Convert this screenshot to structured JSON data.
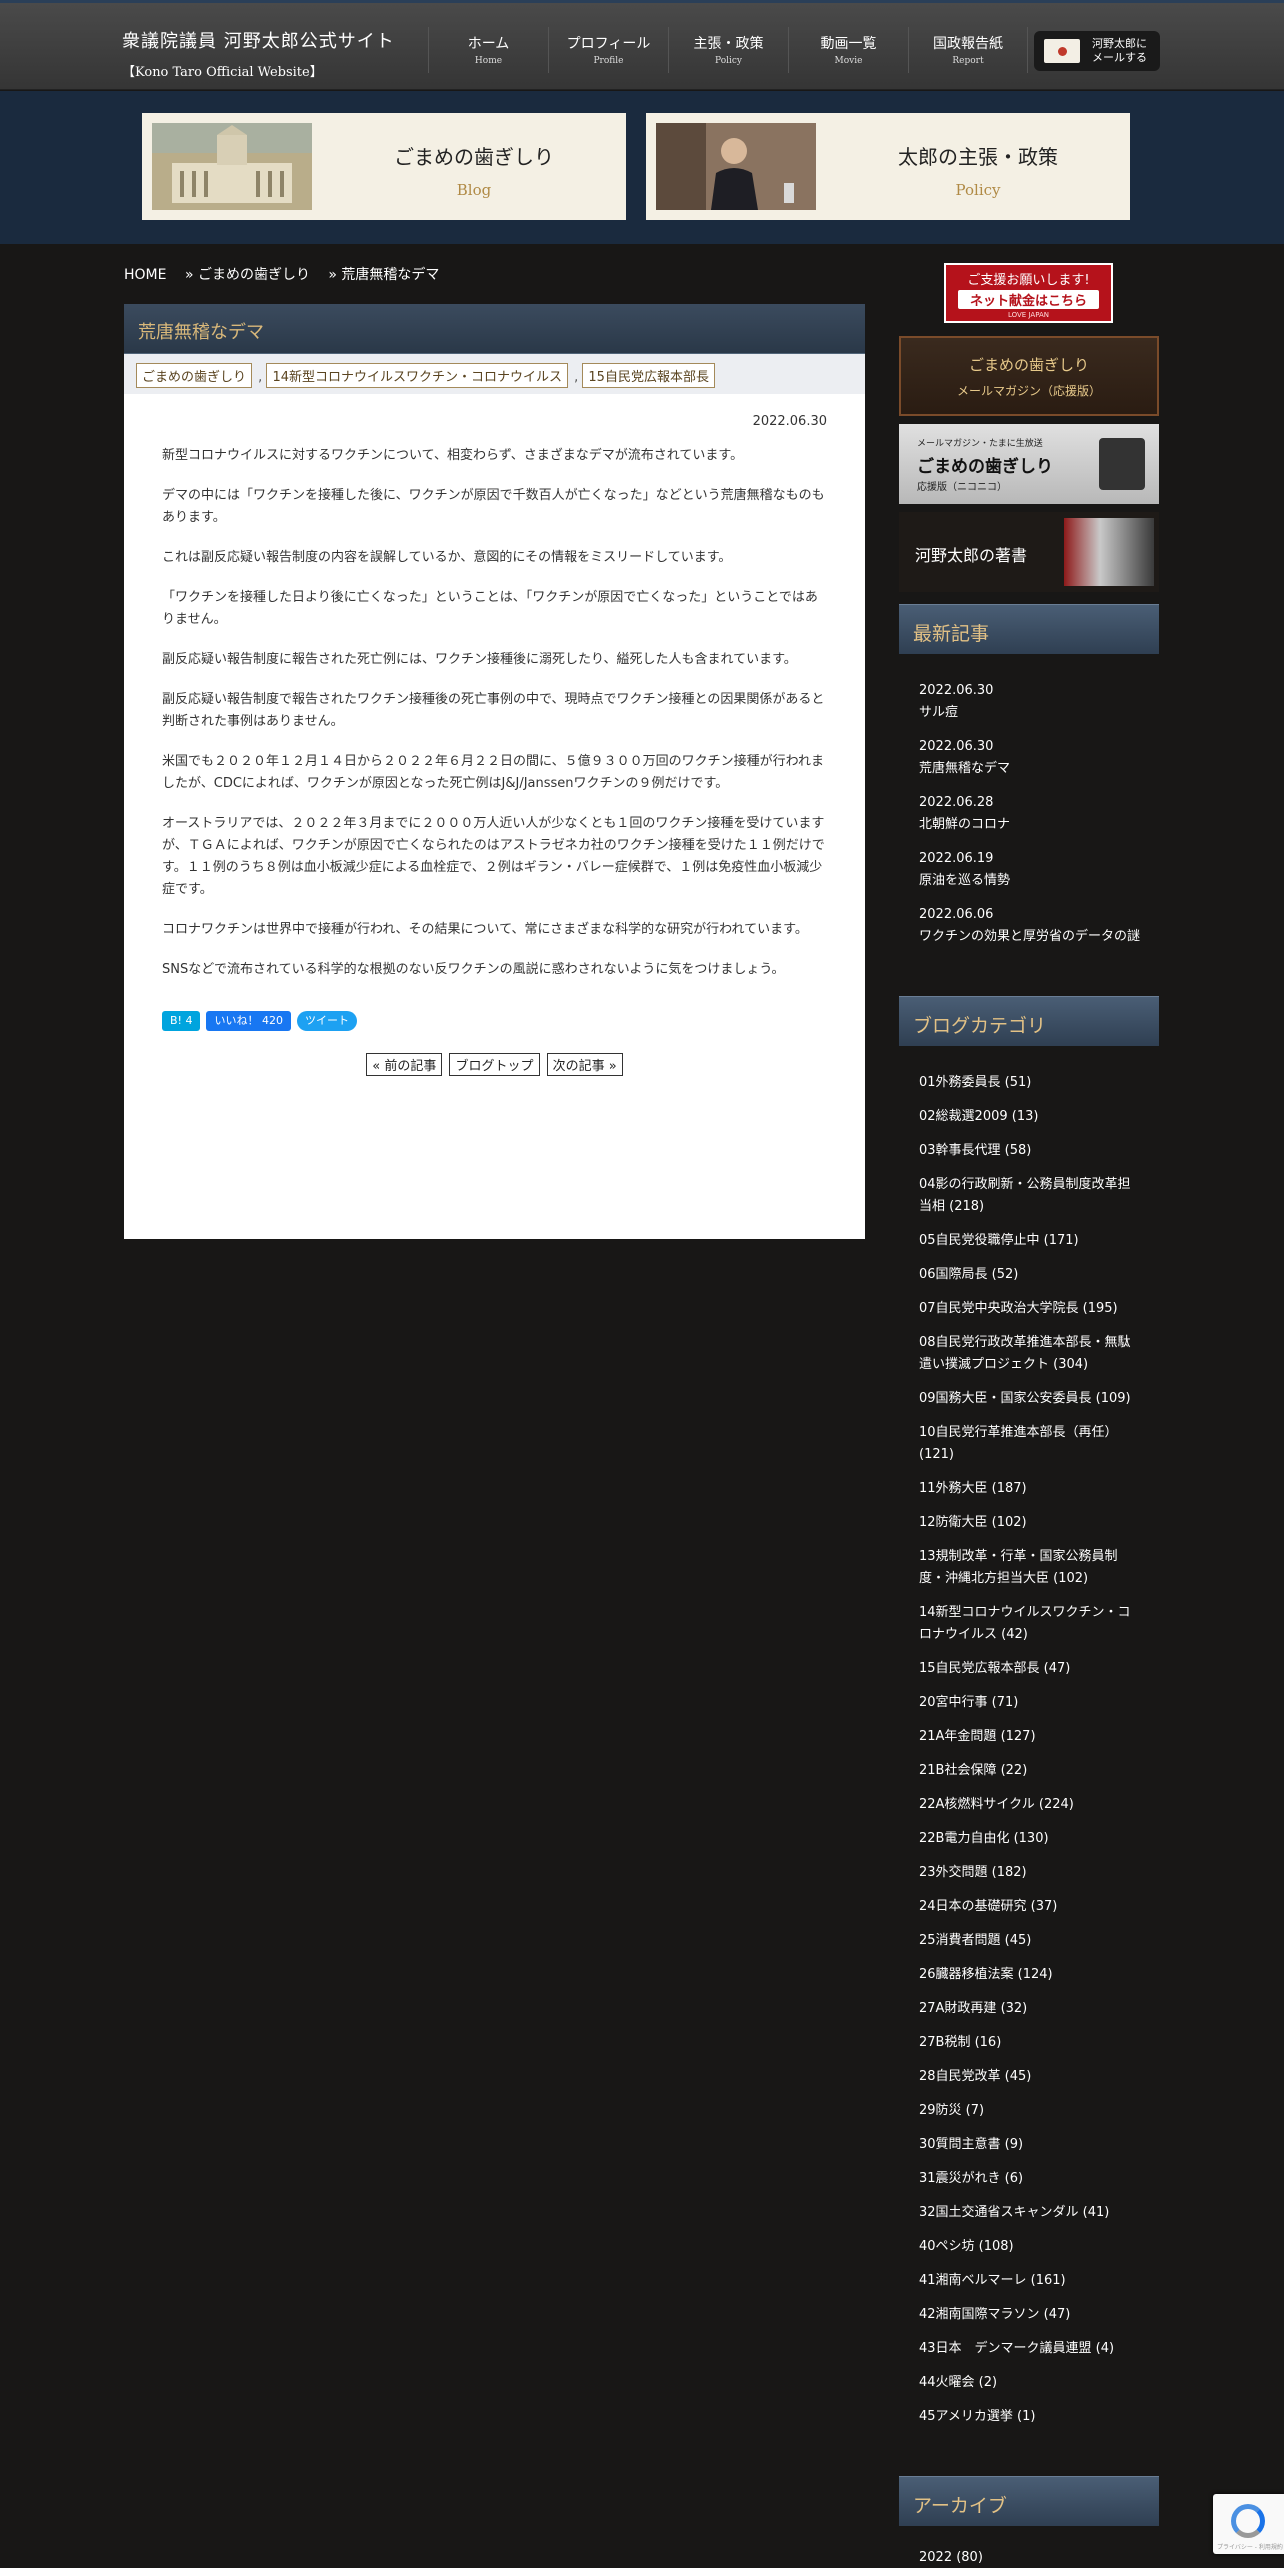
{
  "header": {
    "site_title": "衆議院議員 河野太郎公式サイト",
    "site_subtitle": "【Kono Taro Official Website】",
    "nav": [
      {
        "jp": "ホーム",
        "en": "Home"
      },
      {
        "jp": "プロフィール",
        "en": "Profile"
      },
      {
        "jp": "主張・政策",
        "en": "Policy"
      },
      {
        "jp": "動画一覧",
        "en": "Movie"
      },
      {
        "jp": "国政報告紙",
        "en": "Report"
      }
    ],
    "mail_line1": "河野太郎に",
    "mail_line2": "メールする"
  },
  "banners": [
    {
      "title": "ごまめの歯ぎしり",
      "sub": "Blog"
    },
    {
      "title": "太郎の主張・政策",
      "sub": "Policy"
    }
  ],
  "breadcrumb": {
    "home": "HOME",
    "level1": "» ごまめの歯ぎしり",
    "level2": "» 荒唐無稽なデマ"
  },
  "post": {
    "title": "荒唐無稽なデマ",
    "tags": [
      "ごまめの歯ぎしり",
      "14新型コロナウイルスワクチン・コロナウイルス",
      "15自民党広報本部長"
    ],
    "sep": ",",
    "date": "2022.06.30",
    "paragraphs": [
      "新型コロナウイルスに対するワクチンについて、相変わらず、さまざまなデマが流布されています。",
      "デマの中には「ワクチンを接種した後に、ワクチンが原因で千数百人が亡くなった」などという荒唐無稽なものもあります。",
      "これは副反応疑い報告制度の内容を誤解しているか、意図的にその情報をミスリードしています。",
      "「ワクチンを接種した日より後に亡くなった」ということは、「ワクチンが原因で亡くなった」ということではありません。",
      "副反応疑い報告制度に報告された死亡例には、ワクチン接種後に溺死したり、縊死した人も含まれています。",
      "副反応疑い報告制度で報告されたワクチン接種後の死亡事例の中で、現時点でワクチン接種との因果関係があると判断された事例はありません。",
      "米国でも２０２０年１２月１４日から２０２２年６月２２日の間に、５億９３００万回のワクチン接種が行われましたが、CDCによれば、ワクチンが原因となった死亡例はJ&J/Janssenワクチンの９例だけです。",
      "オーストラリアでは、２０２２年３月までに２０００万人近い人が少なくとも１回のワクチン接種を受けていますが、ＴＧＡによれば、ワクチンが原因で亡くなられたのはアストラゼネカ社のワクチン接種を受けた１１例だけです。１１例のうち８例は血小板減少症による血栓症で、２例はギラン・バレー症候群で、１例は免疫性血小板減少症です。",
      "コロナワクチンは世界中で接種が行われ、その結果について、常にさまざまな科学的な研究が行われています。",
      "SNSなどで流布されている科学的な根拠のない反ワクチンの風説に惑わされないように気をつけましょう。"
    ],
    "share": {
      "hatena": "B! 4",
      "facebook": "いいね！ 420",
      "tweet": "ツイート"
    },
    "pager": {
      "prev": "« 前の記事",
      "top": "ブログトップ",
      "next": "次の記事 »"
    }
  },
  "sidebar": {
    "donate": {
      "line1": "ご支援お願いします!",
      "line2": "ネット献金はこちら",
      "line3": "LOVE JAPAN"
    },
    "gomame_banner": {
      "line1": "ごまめの歯ぎしり",
      "line2": "メールマガジン（応援版）"
    },
    "niconico_banner": {
      "line1": "メールマガジン・たまに生放送",
      "line2": "ごまめの歯ぎしり",
      "line3": "応援版（ニコニコ）"
    },
    "books_banner": {
      "line1": "河野太郎の著書"
    },
    "recent_title": "最新記事",
    "recent": [
      {
        "date": "2022.06.30",
        "title": "サル痘"
      },
      {
        "date": "2022.06.30",
        "title": "荒唐無稽なデマ"
      },
      {
        "date": "2022.06.28",
        "title": "北朝鮮のコロナ"
      },
      {
        "date": "2022.06.19",
        "title": "原油を巡る情勢"
      },
      {
        "date": "2022.06.06",
        "title": "ワクチンの効果と厚労省のデータの謎"
      }
    ],
    "category_title": "ブログカテゴリ",
    "categories": [
      "01外務委員長 (51)",
      "02総裁選2009 (13)",
      "03幹事長代理 (58)",
      "04影の行政刷新・公務員制度改革担当相 (218)",
      "05自民党役職停止中 (171)",
      "06国際局長 (52)",
      "07自民党中央政治大学院長 (195)",
      "08自民党行政改革推進本部長・無駄遣い撲滅プロジェクト (304)",
      "09国務大臣・国家公安委員長 (109)",
      "10自民党行革推進本部長（再任） (121)",
      "11外務大臣 (187)",
      "12防衛大臣 (102)",
      "13規制改革・行革・国家公務員制度・沖縄北方担当大臣 (102)",
      "14新型コロナウイルスワクチン・コロナウイルス (42)",
      "15自民党広報本部長 (47)",
      "20宮中行事 (71)",
      "21A年金問題 (127)",
      "21B社会保障 (22)",
      "22A核燃料サイクル (224)",
      "22B電力自由化 (130)",
      "23外交問題 (182)",
      "24日本の基礎研究 (37)",
      "25消費者問題 (45)",
      "26臓器移植法案 (124)",
      "27A財政再建 (32)",
      "27B税制 (16)",
      "28自民党改革 (45)",
      "29防災 (7)",
      "30質問主意書 (9)",
      "31震災がれき (6)",
      "32国土交通省スキャンダル (41)",
      "40ペシ坊 (108)",
      "41湘南ベルマーレ (161)",
      "42湘南国際マラソン (47)",
      "43日本　デンマーク議員連盟 (4)",
      "44火曜会 (2)",
      "45アメリカ選挙 (1)"
    ],
    "archive_title": "アーカイブ",
    "archive_first": "2022 (80)"
  }
}
